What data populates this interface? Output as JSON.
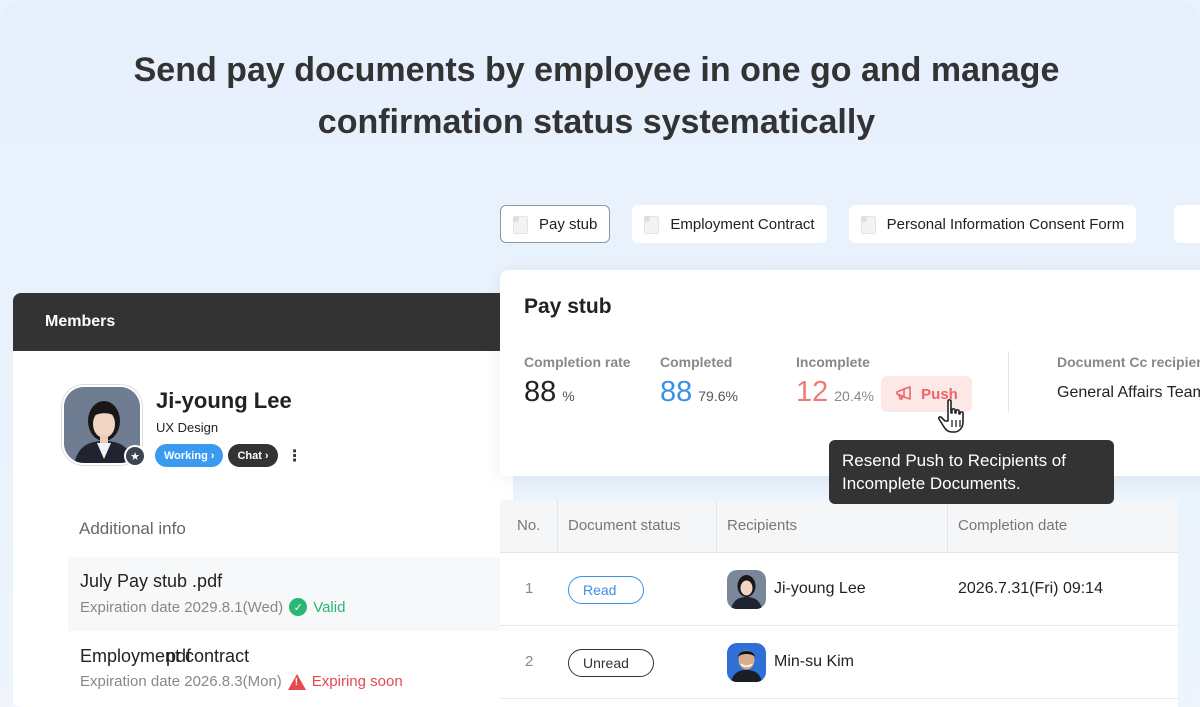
{
  "headline": {
    "line1": "Send pay documents by employee in one go and manage",
    "line2": "confirmation status systematically"
  },
  "tabs": [
    {
      "label": "Pay stub",
      "active": true,
      "icon": "document-icon"
    },
    {
      "label": "Employment Contract",
      "active": false,
      "icon": "document-icon"
    },
    {
      "label": "Personal Information Consent Form",
      "active": false,
      "icon": "document-icon"
    }
  ],
  "members": {
    "header": "Members",
    "profile": {
      "name": "Ji-young Lee",
      "department": "UX Design",
      "status_chip": "Working",
      "chat_chip": "Chat",
      "badge_icon": "star-icon"
    },
    "additional_info": {
      "title": "Additional info",
      "files": [
        {
          "name": "July Pay stub .pdf",
          "expiration": "Expiration date 2029.8.1(Wed)",
          "status": "Valid",
          "status_color": "#2bb673"
        },
        {
          "name": "Employment contract",
          "name_overlay": "pdf",
          "expiration": "Expiration date 2026.8.3(Mon)",
          "status": "Expiring soon",
          "status_color": "#e5484d"
        }
      ]
    }
  },
  "stub_card": {
    "title": "Pay stub",
    "completion_rate": {
      "label": "Completion rate",
      "value": "88",
      "unit": "%"
    },
    "completed": {
      "label": "Completed",
      "value": "88",
      "percent": "79.6%"
    },
    "incomplete": {
      "label": "Incomplete",
      "value": "12",
      "percent": "20.4%"
    },
    "push_button": "Push",
    "cc": {
      "label": "Document Cc recipients",
      "value": "General Affairs Team"
    },
    "tooltip": {
      "line1": "Resend Push to Recipients of",
      "line2": "Incomplete Documents."
    }
  },
  "table": {
    "columns": [
      "No.",
      "Document status",
      "Recipients",
      "Completion date"
    ],
    "rows": [
      {
        "no": "1",
        "status": "Read",
        "recipient": "Ji-young Lee",
        "date": "2026.7.31(Fri) 09:14"
      },
      {
        "no": "2",
        "status": "Unread",
        "recipient": "Min-su Kim",
        "date": ""
      }
    ]
  },
  "colors": {
    "accent_blue": "#3a8fe8",
    "working_chip": "#3a9af0",
    "incomplete_red": "#f07a7a",
    "dark": "#333333"
  }
}
